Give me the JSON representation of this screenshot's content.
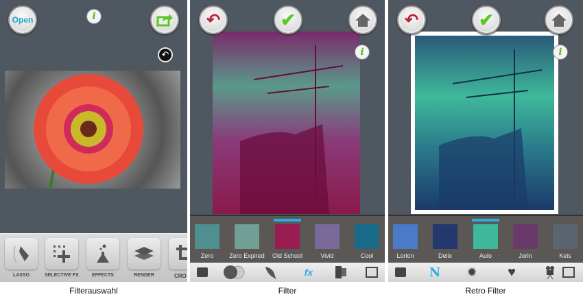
{
  "panels": [
    {
      "caption": "Filterauswahl",
      "open_label": "Open",
      "info_label": "i",
      "tools": [
        "LASSO",
        "SELECTIVE FX",
        "EFFECTS",
        "RENDER",
        "CRO"
      ]
    },
    {
      "caption": "Filter",
      "info_label": "i",
      "filters": [
        "Zero",
        "Zero Expired",
        "Old School",
        "Vivid",
        "Cool"
      ],
      "selected_filter": "Old School",
      "filter_colors": [
        "#4f8f8f",
        "#6f9f95",
        "#9a1d52",
        "#7a6a9a",
        "#1a6a8a"
      ]
    },
    {
      "caption": "Retro Filter",
      "info_label": "i",
      "filters": [
        "Lorion",
        "Delix",
        "Aulo",
        "Jorin",
        "Keis"
      ],
      "selected_filter": "Aulo",
      "filter_colors": [
        "#4a7ac8",
        "#23386e",
        "#3fb89a",
        "#6a3a6a",
        "#5a6570"
      ]
    }
  ],
  "colors": {
    "accent_blue": "#2ab0e8",
    "check_green": "#5cc72a",
    "back_red": "#c0203a"
  }
}
